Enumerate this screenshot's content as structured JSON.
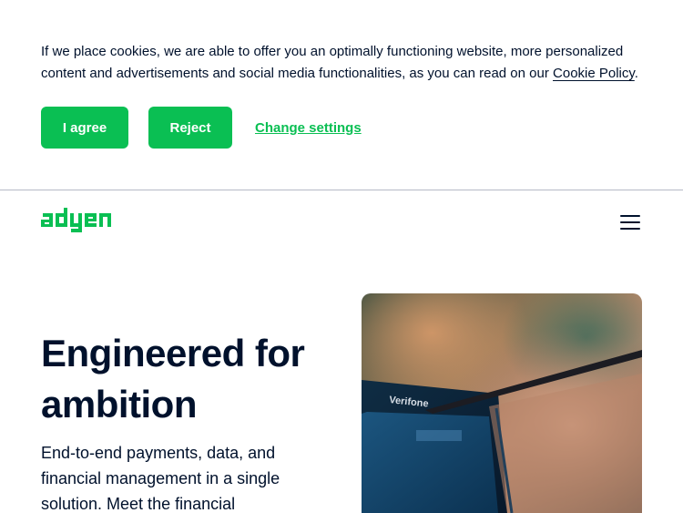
{
  "cookie_banner": {
    "text": "If we place cookies, we are able to offer you an optimally functioning website, more personalized content and advertisements and social media functionalities, as you can read on our",
    "policy_link": "Cookie Policy",
    "period": ".",
    "agree_label": "I agree",
    "reject_label": "Reject",
    "settings_label": "Change settings"
  },
  "header": {
    "logo_text": "adyen",
    "menu_icon": "hamburger-menu-icon"
  },
  "hero": {
    "title": "Engineered for ambition",
    "subtitle": "End-to-end payments, data, and financial management in a single solution. Meet the financial",
    "image_text": "Verifone"
  },
  "colors": {
    "brand_green": "#0abf53",
    "text_dark": "#00112c",
    "divider": "#b5bac6"
  }
}
